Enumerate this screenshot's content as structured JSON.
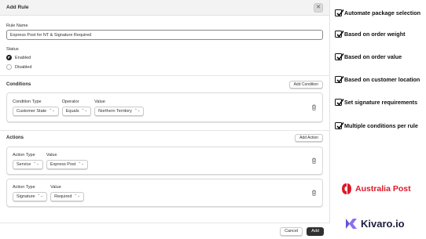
{
  "modal": {
    "title": "Add Rule",
    "close_glyph": "✕",
    "rule_name_label": "Rule Name",
    "rule_name_value": "Express Post for NT & Signature Required",
    "status_label": "Status",
    "status_options": [
      "Enabled",
      "Disabled"
    ],
    "status_selected": "Enabled",
    "conditions": {
      "title": "Conditions",
      "add_label": "Add Condition",
      "items": [
        {
          "type_label": "Condition Type",
          "type_value": "Customer State",
          "operator_label": "Operator",
          "operator_value": "Equals",
          "value_label": "Value",
          "value_value": "Northern Territory"
        }
      ]
    },
    "actions": {
      "title": "Actions",
      "add_label": "Add Action",
      "items": [
        {
          "type_label": "Action Type",
          "type_value": "Service",
          "value_label": "Value",
          "value_value": "Express Post"
        },
        {
          "type_label": "Action Type",
          "type_value": "Signature",
          "value_label": "Value",
          "value_value": "Required"
        }
      ]
    },
    "footer": {
      "cancel_label": "Cancel",
      "add_label": "Add"
    }
  },
  "features": [
    "Automate package selection",
    "Based on order weight",
    "Based on order value",
    "Based on customer location",
    "Set signature requirements",
    "Multiple conditions per rule"
  ],
  "brands": {
    "australia_post": {
      "name": "Australia Post",
      "color": "#dc1928"
    },
    "kivaro": {
      "name": "Kivaro.io",
      "color": "#1d1d3f",
      "accent": "#6b4fd8"
    }
  },
  "icons": {
    "select": "chevron-up-down-icon",
    "delete": "trash-icon",
    "feature": "checkbox-checked-icon"
  }
}
